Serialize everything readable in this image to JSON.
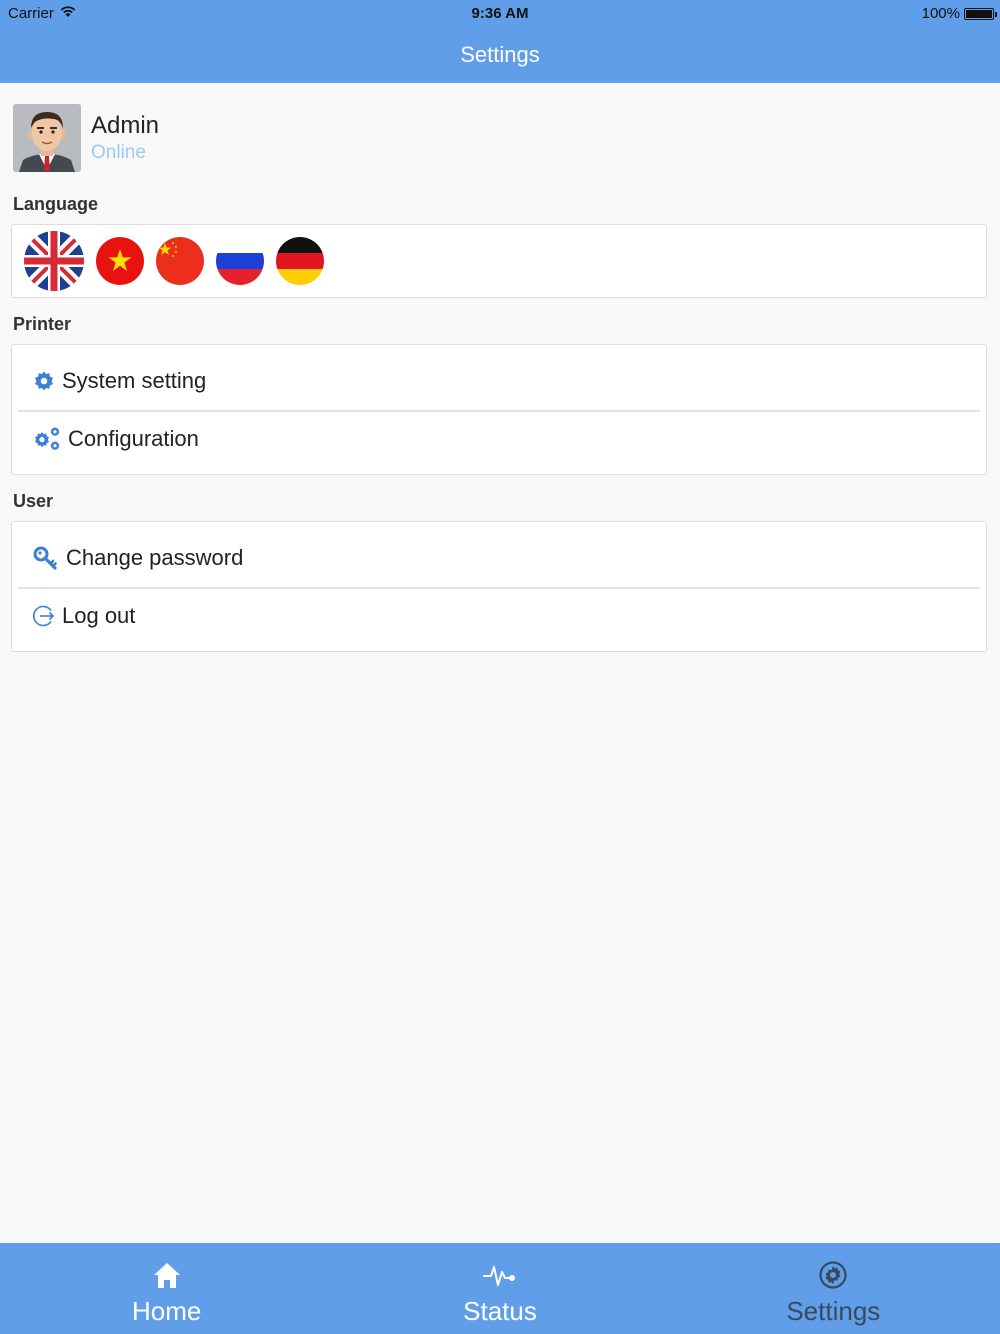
{
  "status_bar": {
    "carrier": "Carrier",
    "time": "9:36 AM",
    "battery": "100%"
  },
  "nav": {
    "title": "Settings"
  },
  "profile": {
    "name": "Admin",
    "status": "Online"
  },
  "sections": {
    "language": {
      "label": "Language",
      "flags": [
        "uk-flag-icon",
        "vietnam-flag-icon",
        "china-flag-icon",
        "russia-flag-icon",
        "germany-flag-icon"
      ]
    },
    "printer": {
      "label": "Printer",
      "items": [
        {
          "label": "System setting",
          "icon": "gear-icon"
        },
        {
          "label": "Configuration",
          "icon": "gears-icon"
        }
      ]
    },
    "user": {
      "label": "User",
      "items": [
        {
          "label": "Change password",
          "icon": "key-icon"
        },
        {
          "label": "Log out",
          "icon": "logout-icon"
        }
      ]
    }
  },
  "tabbar": {
    "tabs": [
      {
        "label": "Home",
        "icon": "home-icon"
      },
      {
        "label": "Status",
        "icon": "pulse-icon"
      },
      {
        "label": "Settings",
        "icon": "gear-icon",
        "active": true
      }
    ]
  },
  "colors": {
    "accent": "#619ee9",
    "icon_blue": "#3d7fd1",
    "online": "#9fc7f2",
    "active_tab_text": "#3a4a5e"
  }
}
